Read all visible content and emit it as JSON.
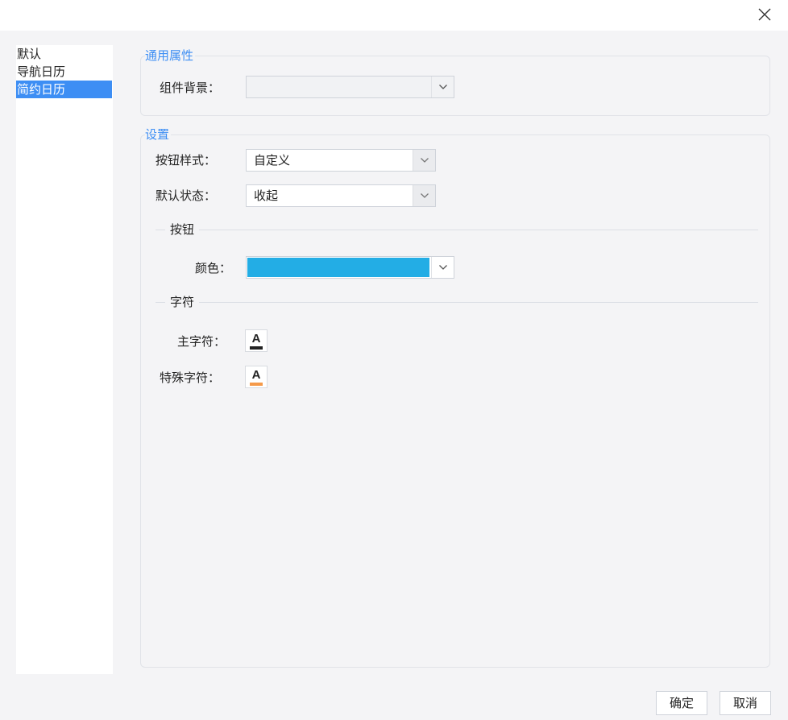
{
  "window": {
    "close_icon": "close-icon"
  },
  "sidebar": {
    "items": [
      {
        "label": "默认"
      },
      {
        "label": "导航日历"
      },
      {
        "label": "简约日历",
        "selected": true
      }
    ]
  },
  "general": {
    "legend": "通用属性",
    "background_label": "组件背景：",
    "background_value": ""
  },
  "settings": {
    "legend": "设置",
    "button_style_label": "按钮样式：",
    "button_style_value": "自定义",
    "default_state_label": "默认状态：",
    "default_state_value": "收起",
    "button_group": {
      "legend": "按钮",
      "color_label": "颜色：",
      "color_value": "#23ade5"
    },
    "char_group": {
      "legend": "字符",
      "main_char_label": "主字符：",
      "main_char_color": "#222222",
      "special_char_label": "特殊字符：",
      "special_char_color": "#f59a4a",
      "font_glyph": "A"
    }
  },
  "footer": {
    "ok_label": "确定",
    "cancel_label": "取消"
  },
  "colors": {
    "accent": "#3d8ef4",
    "panel_bg": "#f4f4f6"
  }
}
